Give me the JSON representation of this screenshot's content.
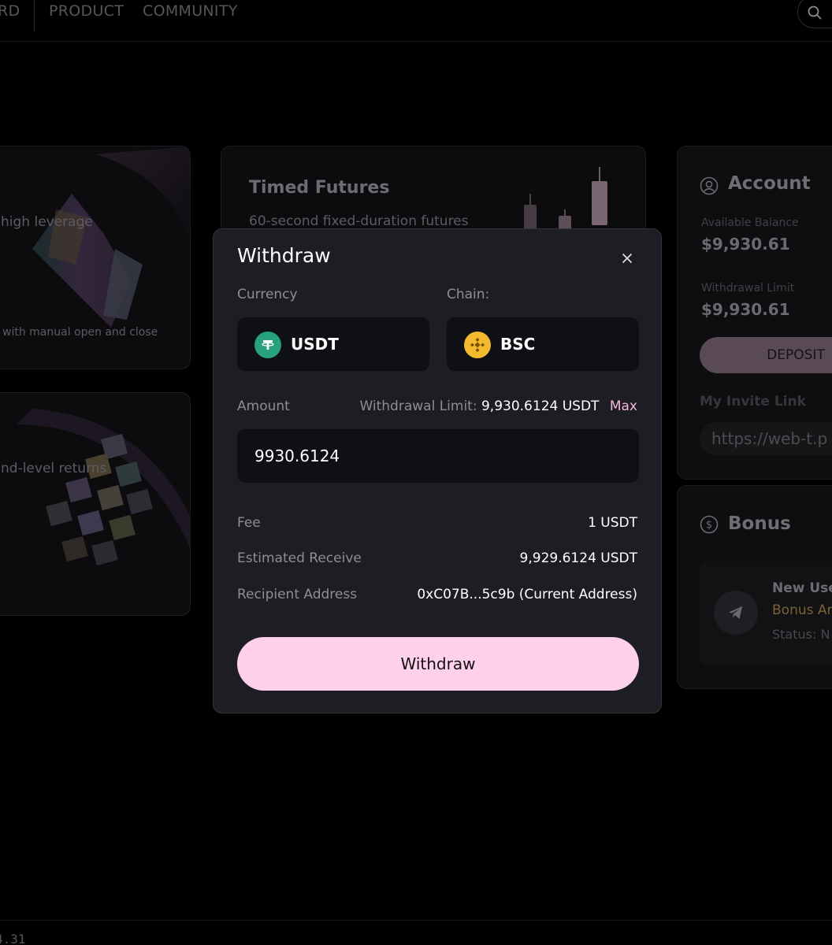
{
  "nav": {
    "item_cut": "RD",
    "product": "PRODUCT",
    "community": "COMMUNITY"
  },
  "cards": {
    "perpetual": {
      "desc_cut": "high leverage",
      "footnote_cut": "with manual open and close"
    },
    "timed": {
      "title": "Timed Futures",
      "subtitle": "60-second fixed-duration futures"
    },
    "earn": {
      "desc_cut": "nd-level returns"
    }
  },
  "account": {
    "title": "Account",
    "available_label": "Available Balance",
    "available_value": "$9,930.61",
    "limit_label": "Withdrawal Limit",
    "limit_value": "$9,930.61",
    "deposit_label": "DEPOSIT",
    "invite_label": "My Invite Link",
    "invite_value": "https://web-t.p"
  },
  "bonus": {
    "title": "Bonus",
    "item_title_cut": "New Use",
    "item_amount_cut": "Bonus Ar",
    "item_status_cut": "Status: N"
  },
  "modal": {
    "title": "Withdraw",
    "currency_label": "Currency",
    "chain_label": "Chain:",
    "currency_value": "USDT",
    "chain_value": "BSC",
    "amount_label": "Amount",
    "limit_label": "Withdrawal Limit:",
    "limit_value": "9,930.6124 USDT",
    "max_label": "Max",
    "amount_value": "9930.6124",
    "fee_label": "Fee",
    "fee_value": "1 USDT",
    "receive_label": "Estimated Receive",
    "receive_value": "9,929.6124 USDT",
    "address_label": "Recipient Address",
    "address_value": "0xC07B...5c9b (Current Address)",
    "submit_label": "Withdraw"
  },
  "footer": {
    "text_cut": "4.31"
  },
  "icons": {
    "search": "search-icon",
    "close": "close-icon",
    "user": "user-circle-icon",
    "dollar": "dollar-circle-icon",
    "usdt": "usdt-logo-icon",
    "bsc": "bnb-logo-icon",
    "telegram": "telegram-icon"
  },
  "colors": {
    "modal_bg": "#1d1e24",
    "input_bg": "#0f1014",
    "accent_pink": "#fed0eb",
    "max_link": "#f5b8df",
    "usdt_green": "#26a17b",
    "bnb_yellow": "#f3ba2f"
  }
}
